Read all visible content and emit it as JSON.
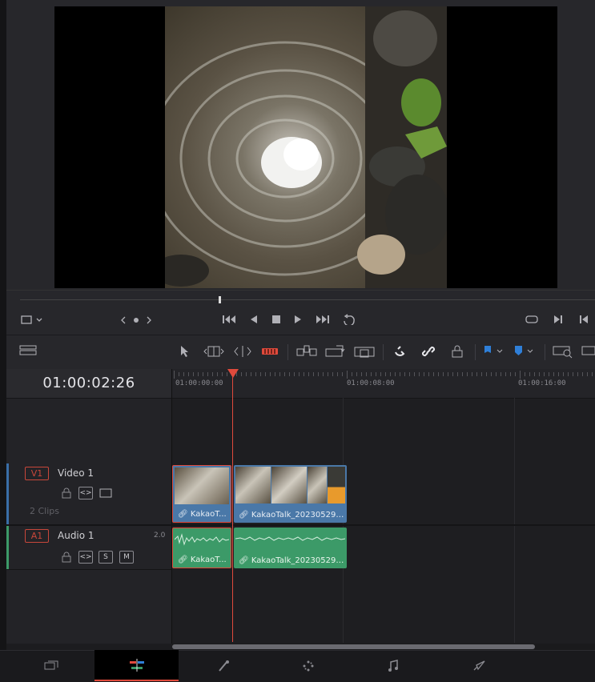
{
  "timeline": {
    "timecode": "01:00:02:26",
    "ruler_labels": [
      "01:00:00:00",
      "01:00:08:00",
      "01:00:16:00"
    ]
  },
  "tracks": {
    "video1": {
      "tag": "V1",
      "name": "Video 1",
      "clip_count": "2 Clips"
    },
    "audio1": {
      "tag": "A1",
      "name": "Audio 1",
      "channel": "2.0",
      "solo": "S",
      "mute": "M"
    }
  },
  "clips": {
    "video_clip_1": "KakaoT...",
    "video_clip_2": "KakaoTalk_20230529_0...",
    "audio_clip_1": "KakaoT...",
    "audio_clip_2": "KakaoTalk_20230529_0..."
  },
  "colors": {
    "playhead": "#e04a3c",
    "video_clip": "#4a78a8",
    "audio_clip": "#3c9a68",
    "accent_blue": "#2f7fd8"
  },
  "icons": {
    "pages": [
      "media-icon",
      "cut-edit-icon",
      "fusion-icon",
      "color-icon",
      "fairlight-icon",
      "deliver-icon"
    ]
  }
}
